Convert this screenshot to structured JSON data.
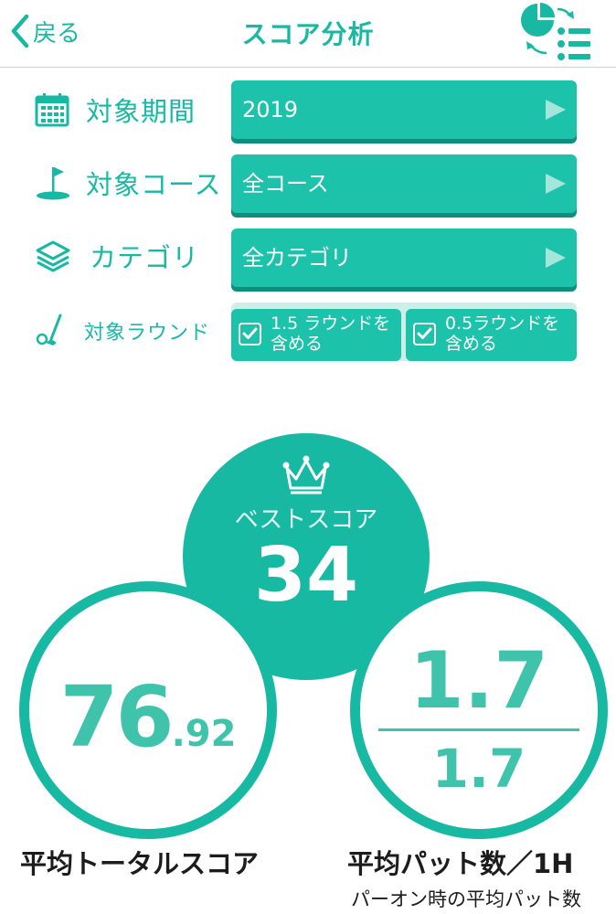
{
  "header": {
    "back_label": "戻る",
    "title": "スコア分析"
  },
  "filters": {
    "period": {
      "label": "対象期間",
      "value": "2019"
    },
    "course": {
      "label": "対象コース",
      "value": "全コース"
    },
    "category": {
      "label": "カテゴリ",
      "value": "全カテゴリ"
    },
    "round": {
      "label": "対象ラウンド",
      "options": [
        {
          "text": "1.5 ラウンドを 含める",
          "checked": true
        },
        {
          "text": "0.5ラウンドを 含める",
          "checked": true
        }
      ]
    }
  },
  "stats": {
    "best_score": {
      "label": "ベストスコア",
      "value": "34"
    },
    "average_total": {
      "integer": "76",
      "decimal": ".92",
      "caption": "平均トータルスコア"
    },
    "average_putts": {
      "top": "1.7",
      "bottom": "1.7",
      "caption": "平均パット数／1H",
      "subcaption": "パーオン時の平均パット数"
    }
  },
  "colors": {
    "accent": "#18b9a3",
    "button": "#1dc2ab",
    "button_shadow": "#0d8f7d"
  }
}
